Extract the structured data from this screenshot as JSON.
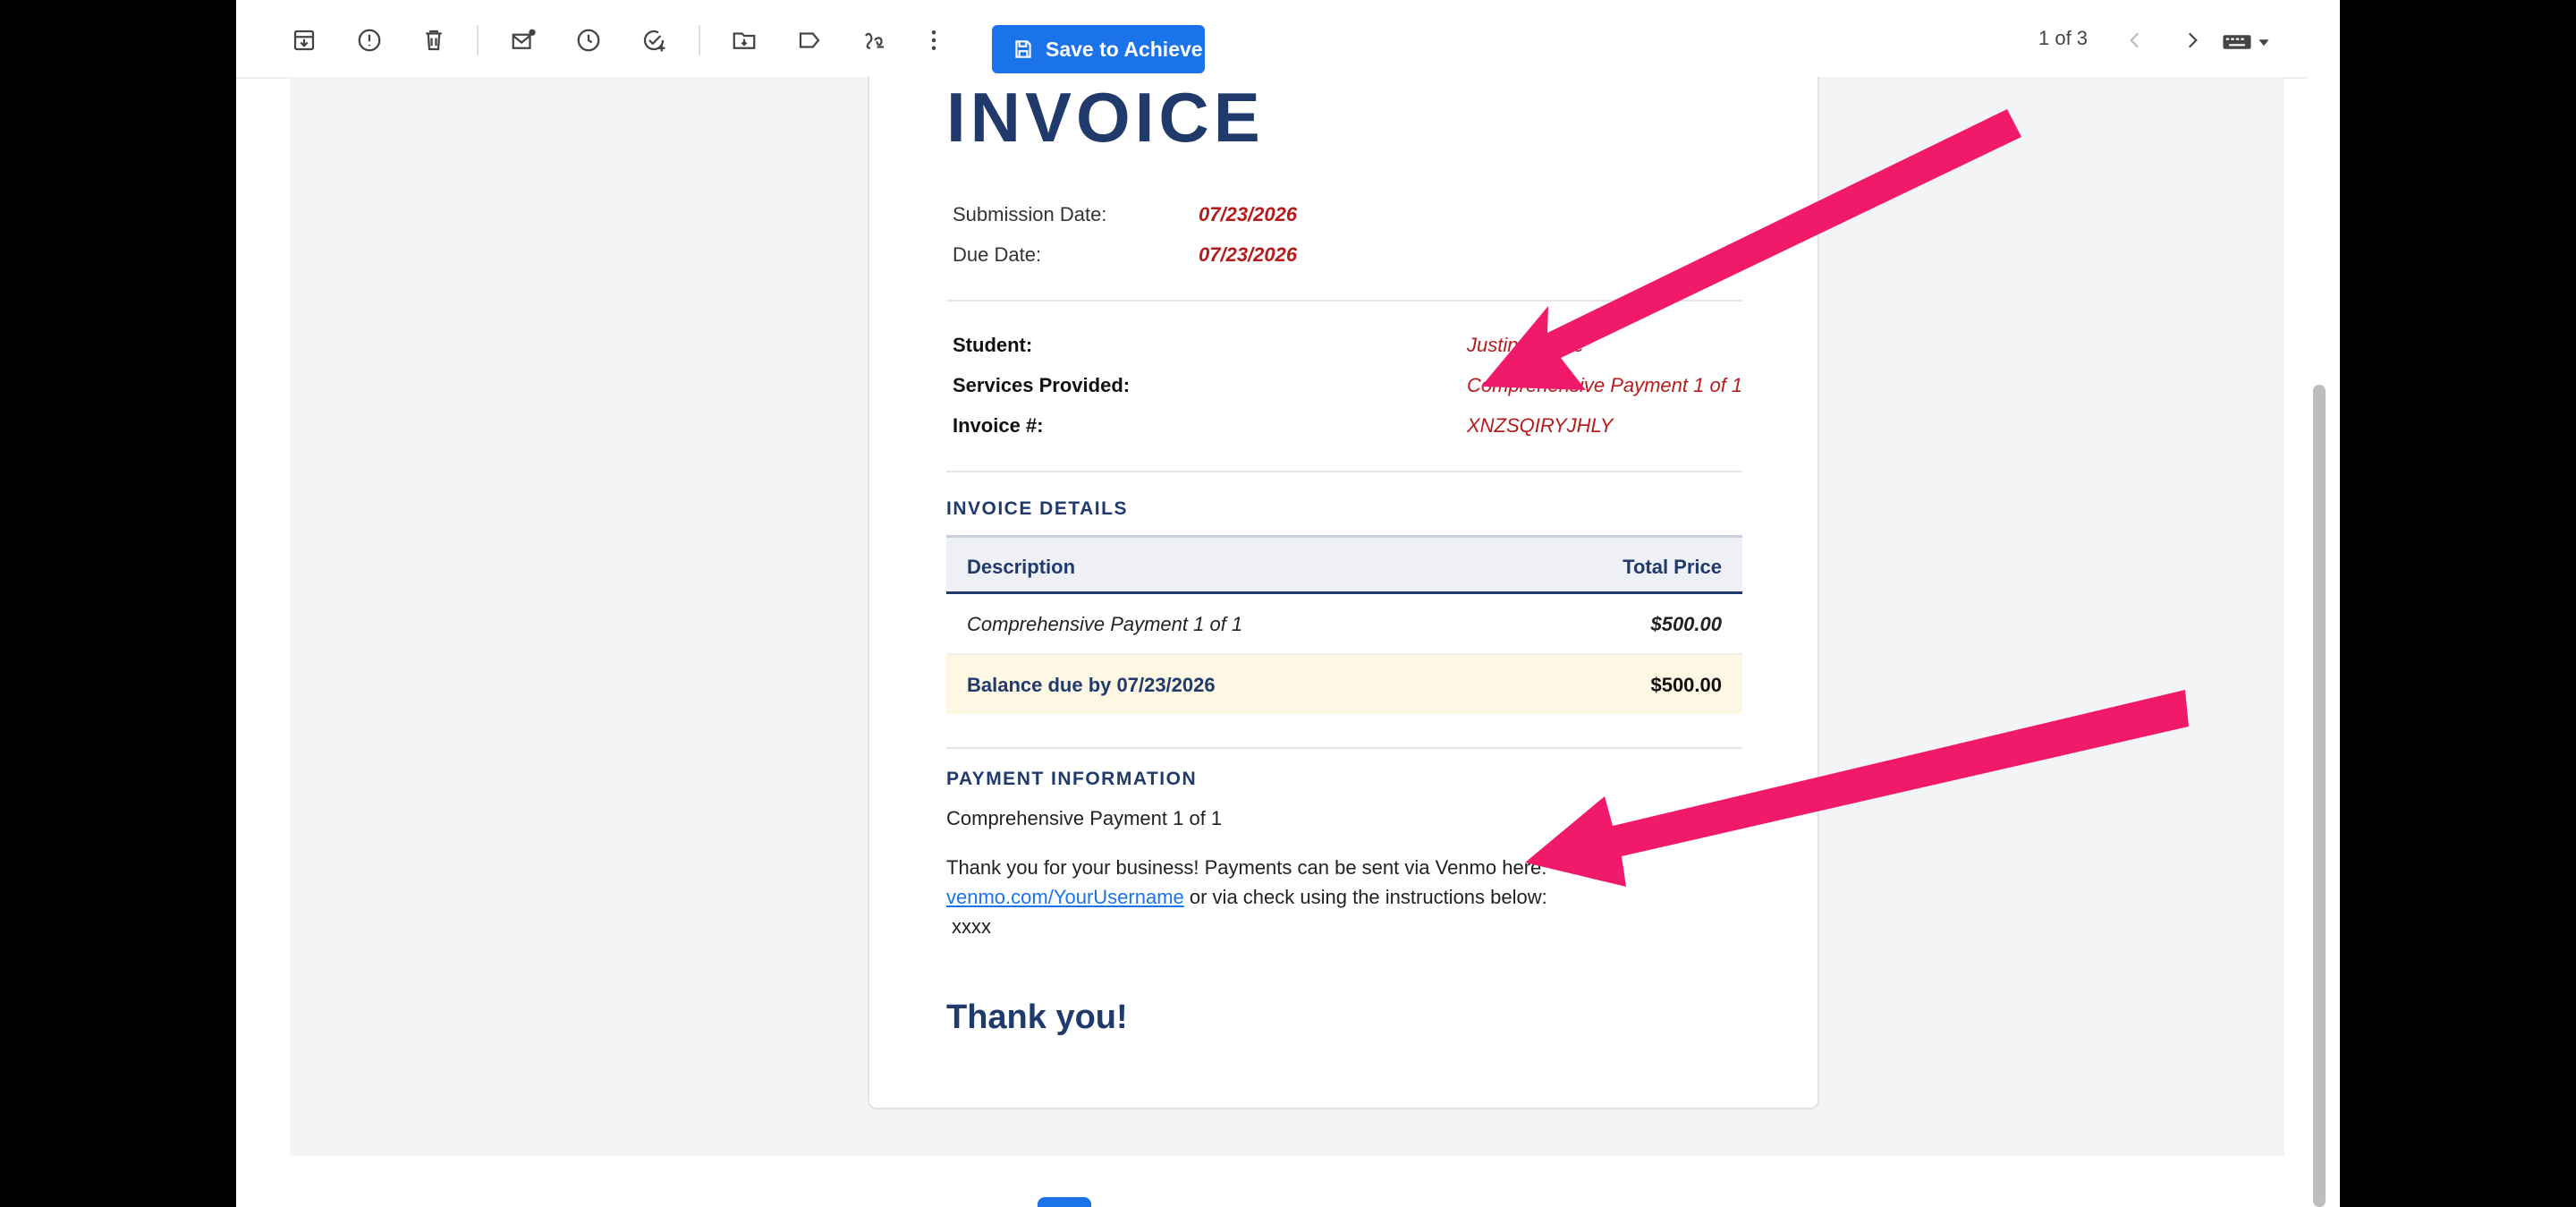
{
  "toolbar": {
    "icons": [
      "archive-icon",
      "report-spam-icon",
      "delete-icon",
      "mark-unread-icon",
      "snooze-icon",
      "add-task-icon",
      "move-to-icon",
      "label-icon",
      "filter-icon",
      "more-vert-icon"
    ],
    "save_label": "Save to Achieve",
    "pager_text": "1 of 3"
  },
  "invoice": {
    "title": "INVOICE",
    "submission_label": "Submission Date:",
    "submission_value": "07/23/2026",
    "due_label": "Due Date:",
    "due_value": "07/23/2026",
    "student_label": "Student:",
    "student_value": "Justin Thyme",
    "services_label": "Services Provided:",
    "services_value": "Comprehensive Payment 1 of 1",
    "invoice_no_label": "Invoice #:",
    "invoice_no_value": "XNZSQIRYJHLY",
    "details_heading": "INVOICE DETAILS",
    "table": {
      "col_description": "Description",
      "col_total": "Total Price",
      "row_description": "Comprehensive Payment 1 of 1",
      "row_total": "$500.00",
      "balance_label": "Balance due by 07/23/2026",
      "balance_total": "$500.00"
    },
    "payment_heading": "PAYMENT INFORMATION",
    "payment_plan": "Comprehensive Payment 1 of 1",
    "payment_text_1": "Thank you for your business! Payments can be sent via Venmo here:",
    "payment_link": "venmo.com/YourUsername",
    "payment_text_2": " or via check using the instructions below:",
    "payment_text_3": "xxxx",
    "thanks": "Thank you!"
  },
  "colors": {
    "navy": "#1f3a6b",
    "red_value": "#b71c1c",
    "accent_blue": "#1a73e8",
    "annotation_arrow": "#f0196a",
    "balance_row": "#fdf7e3"
  }
}
